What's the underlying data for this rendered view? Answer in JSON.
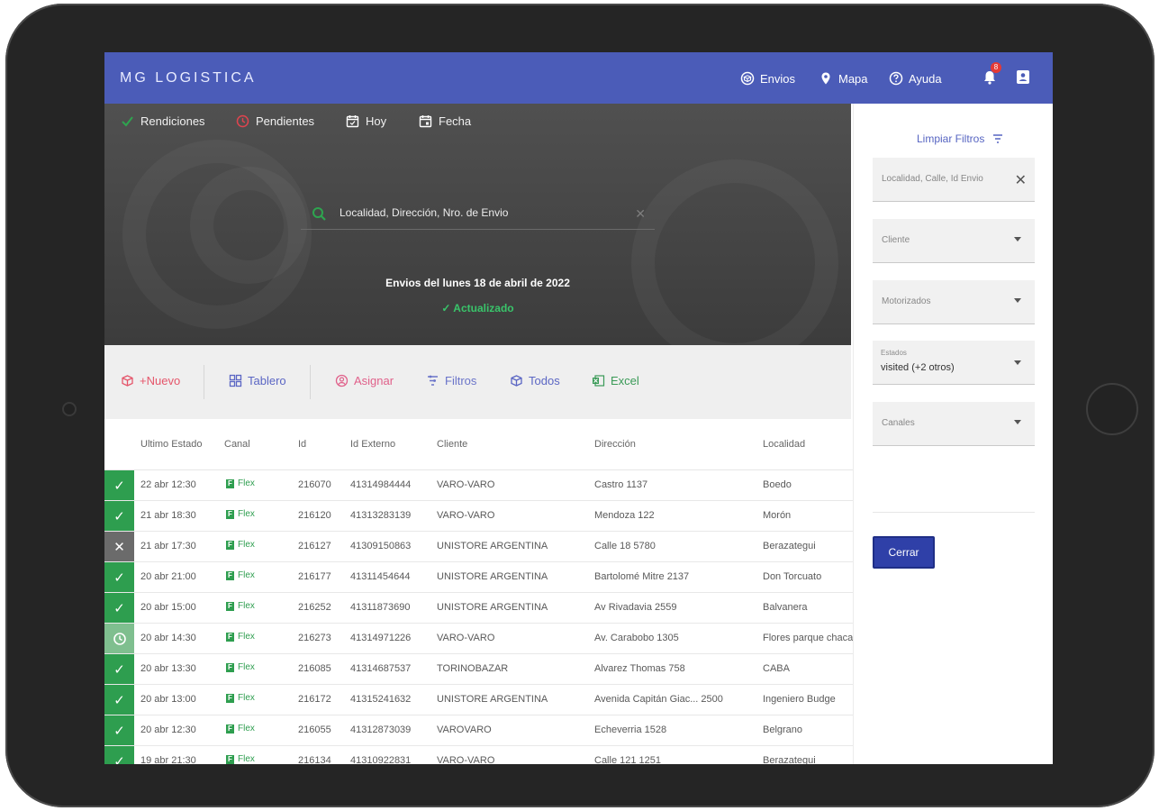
{
  "app": {
    "brand": "MG LOGISTICA",
    "nav": [
      {
        "label": "Envios",
        "icon": "box-icon"
      },
      {
        "label": "Mapa",
        "icon": "map-pin-icon"
      },
      {
        "label": "Ayuda",
        "icon": "help-icon"
      }
    ],
    "notifications_count": "8"
  },
  "hero": {
    "tabs": [
      {
        "label": "Rendiciones",
        "icon": "check-icon"
      },
      {
        "label": "Pendientes",
        "icon": "clock-icon"
      },
      {
        "label": "Hoy",
        "icon": "calendar-icon"
      },
      {
        "label": "Fecha",
        "icon": "calendar-icon"
      }
    ],
    "search_value": "Localidad, Dirección, Nro. de Envio",
    "date_title": "Envios del lunes 18 de abril de 2022",
    "status": "✓ Actualizado"
  },
  "toolbar": {
    "nuevo": "+Nuevo",
    "tablero": "Tablero",
    "asignar": "Asignar",
    "filtros": "Filtros",
    "todos": "Todos",
    "excel": "Excel"
  },
  "table": {
    "columns": [
      "Ultimo Estado",
      "Canal",
      "Id",
      "Id Externo",
      "Cliente",
      "Dirección",
      "Localidad"
    ],
    "rows": [
      {
        "status": "ok",
        "fecha": "22 abr 12:30",
        "canal": "Flex",
        "id": "216070",
        "ext": "41314984444",
        "cliente": "VARO-VARO",
        "dir": "Castro 1137",
        "loc": "Boedo"
      },
      {
        "status": "ok",
        "fecha": "21 abr 18:30",
        "canal": "Flex",
        "id": "216120",
        "ext": "41313283139",
        "cliente": "VARO-VARO",
        "dir": "Mendoza 122",
        "loc": "Morón"
      },
      {
        "status": "cancel",
        "fecha": "21 abr 17:30",
        "canal": "Flex",
        "id": "216127",
        "ext": "41309150863",
        "cliente": "UNISTORE ARGENTINA",
        "dir": "Calle 18 5780",
        "loc": "Berazategui"
      },
      {
        "status": "ok",
        "fecha": "20 abr 21:00",
        "canal": "Flex",
        "id": "216177",
        "ext": "41311454644",
        "cliente": "UNISTORE ARGENTINA",
        "dir": "Bartolomé Mitre 2137",
        "loc": "Don Torcuato"
      },
      {
        "status": "ok",
        "fecha": "20 abr 15:00",
        "canal": "Flex",
        "id": "216252",
        "ext": "41311873690",
        "cliente": "UNISTORE ARGENTINA",
        "dir": "Av Rivadavia 2559",
        "loc": "Balvanera"
      },
      {
        "status": "pending",
        "fecha": "20 abr 14:30",
        "canal": "Flex",
        "id": "216273",
        "ext": "41314971226",
        "cliente": "VARO-VARO",
        "dir": "Av. Carabobo 1305",
        "loc": "Flores parque chacabuco"
      },
      {
        "status": "ok",
        "fecha": "20 abr 13:30",
        "canal": "Flex",
        "id": "216085",
        "ext": "41314687537",
        "cliente": "TORINOBAZAR",
        "dir": "Alvarez Thomas 758",
        "loc": "CABA"
      },
      {
        "status": "ok",
        "fecha": "20 abr 13:00",
        "canal": "Flex",
        "id": "216172",
        "ext": "41315241632",
        "cliente": "UNISTORE ARGENTINA",
        "dir": "Avenida Capitán Giac... 2500",
        "loc": "Ingeniero Budge"
      },
      {
        "status": "ok",
        "fecha": "20 abr 12:30",
        "canal": "Flex",
        "id": "216055",
        "ext": "41312873039",
        "cliente": "VAROVARO",
        "dir": "Echeverria 1528",
        "loc": "Belgrano"
      },
      {
        "status": "ok",
        "fecha": "19 abr 21:30",
        "canal": "Flex",
        "id": "216134",
        "ext": "41310922831",
        "cliente": "VARO-VARO",
        "dir": "Calle 121 1251",
        "loc": "Berazategui"
      }
    ]
  },
  "filters": {
    "limpiar": "Limpiar Filtros",
    "search_placeholder": "Localidad, Calle, Id Envio",
    "cliente": "Cliente",
    "motorizados": "Motorizados",
    "estados_label": "Estados",
    "estados_value": "visited (+2 otros)",
    "canales": "Canales",
    "cerrar": "Cerrar"
  },
  "colors": {
    "header": "#4b5cb8",
    "ok": "#2e9e4f",
    "cancel": "#6b6b6b",
    "pending": "#7fbf8f",
    "nuevo": "#e5566b",
    "asignar": "#e0608a",
    "excel": "#3a9a57"
  }
}
